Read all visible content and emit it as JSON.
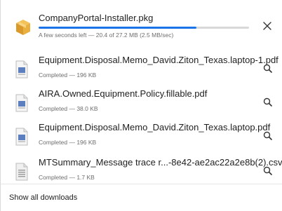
{
  "downloads_panel": {
    "items": [
      {
        "name": "CompanyPortal-Installer.pkg",
        "status": "A few seconds left — 20.4 of 27.2 MB (2.5 MB/sec)",
        "progress_fraction": 0.75,
        "file_icon": "package-box-icon",
        "action_icon": "close-icon",
        "state": "downloading"
      },
      {
        "name": "Equipment.Disposal.Memo_David.Ziton_Texas.laptop-1.pdf",
        "status": "Completed — 196 KB",
        "file_icon": "pdf-file-icon",
        "action_icon": "magnifier-icon",
        "state": "completed"
      },
      {
        "name": "AIRA.Owned.Equipment.Policy.fillable.pdf",
        "status": "Completed — 38.0 KB",
        "file_icon": "pdf-file-icon",
        "action_icon": "magnifier-icon",
        "state": "completed"
      },
      {
        "name": "Equipment.Disposal.Memo_David.Ziton_Texas.laptop.pdf",
        "status": "Completed — 196 KB",
        "file_icon": "pdf-file-icon",
        "action_icon": "magnifier-icon",
        "state": "completed"
      },
      {
        "name": "MTSummary_Message trace r...-8e42-ae2ac22a2e8b(2).csv",
        "status": "Completed — 1.7 KB",
        "file_icon": "csv-file-icon",
        "action_icon": "magnifier-icon",
        "state": "completed"
      }
    ],
    "footer_label": "Show all downloads"
  },
  "colors": {
    "progress": "#1a73e8",
    "track": "#d8d8d8",
    "muted_text": "#6e6e6e"
  }
}
